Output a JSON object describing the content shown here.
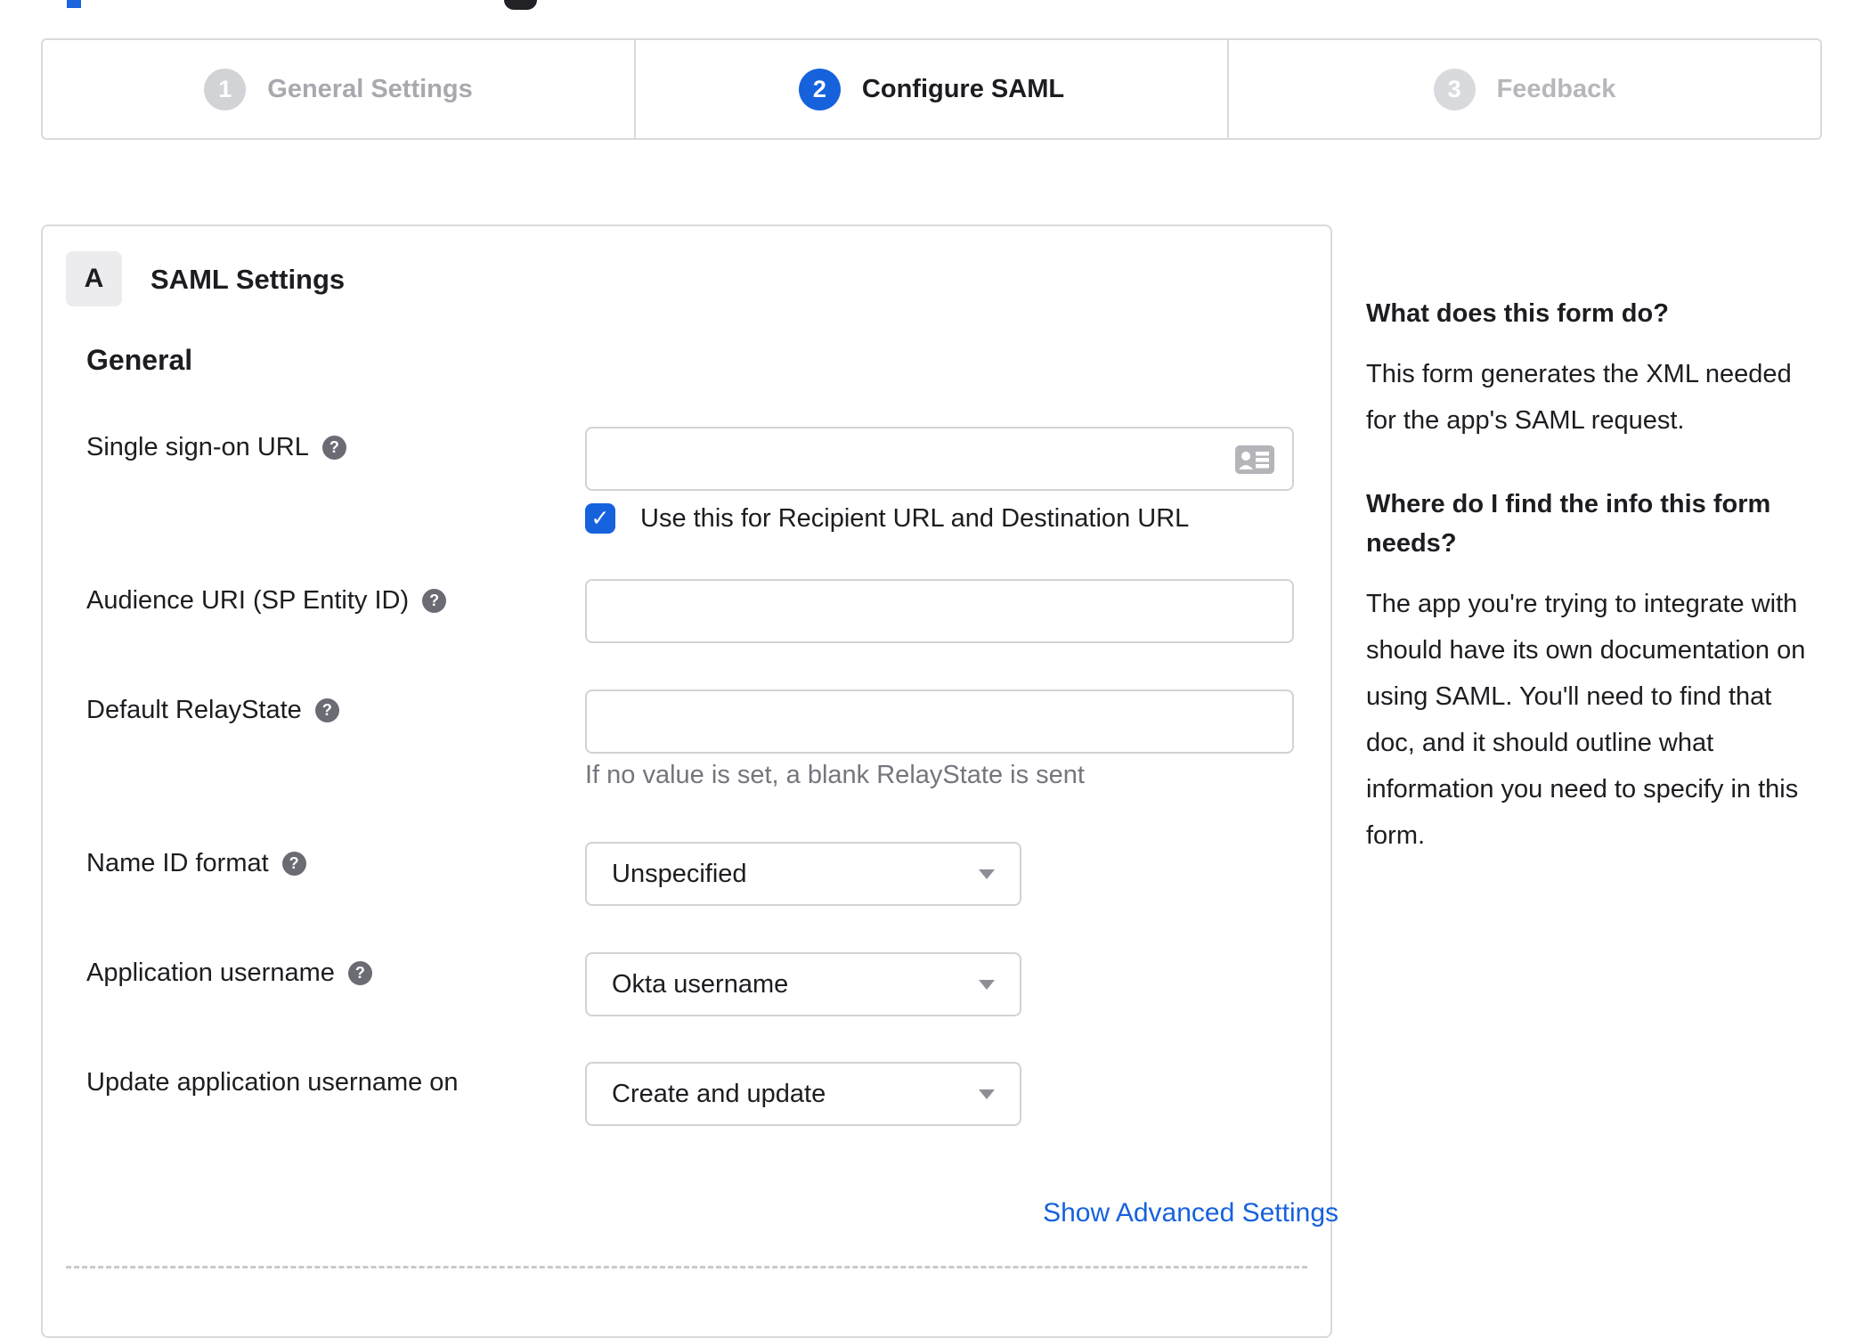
{
  "icons": {
    "help": "?",
    "check": "✓"
  },
  "colors": {
    "accent_blue": "#1662dd",
    "inactive_gray": "#d2d3d7",
    "text_dark": "#1d1d21",
    "hint_gray": "#75757e"
  },
  "stepper": {
    "steps": [
      {
        "number": "1",
        "label": "General Settings",
        "state": "complete"
      },
      {
        "number": "2",
        "label": "Configure SAML",
        "state": "active"
      },
      {
        "number": "3",
        "label": "Feedback",
        "state": "upcoming"
      }
    ]
  },
  "panel": {
    "badge": "A",
    "title": "SAML Settings",
    "section_heading": "General",
    "fields": {
      "sso_url": {
        "label": "Single sign-on URL",
        "value": ""
      },
      "sso_checkbox": {
        "checked": true,
        "label": "Use this for Recipient URL and Destination URL"
      },
      "audience_uri": {
        "label": "Audience URI (SP Entity ID)",
        "value": ""
      },
      "default_relay_state": {
        "label": "Default RelayState",
        "value": "",
        "hint": "If no value is set, a blank RelayState is sent"
      },
      "name_id_format": {
        "label": "Name ID format",
        "value": "Unspecified"
      },
      "application_username": {
        "label": "Application username",
        "value": "Okta username"
      },
      "update_app_username_on": {
        "label": "Update application username on",
        "value": "Create and update"
      }
    },
    "advanced_link": "Show Advanced Settings"
  },
  "sidebar": {
    "sections": [
      {
        "heading": "What does this form do?",
        "body": "This form generates the XML needed for the app's SAML request."
      },
      {
        "heading": "Where do I find the info this form needs?",
        "body": "The app you're trying to integrate with should have its own documentation on using SAML. You'll need to find that doc, and it should outline what information you need to specify in this form."
      }
    ]
  }
}
